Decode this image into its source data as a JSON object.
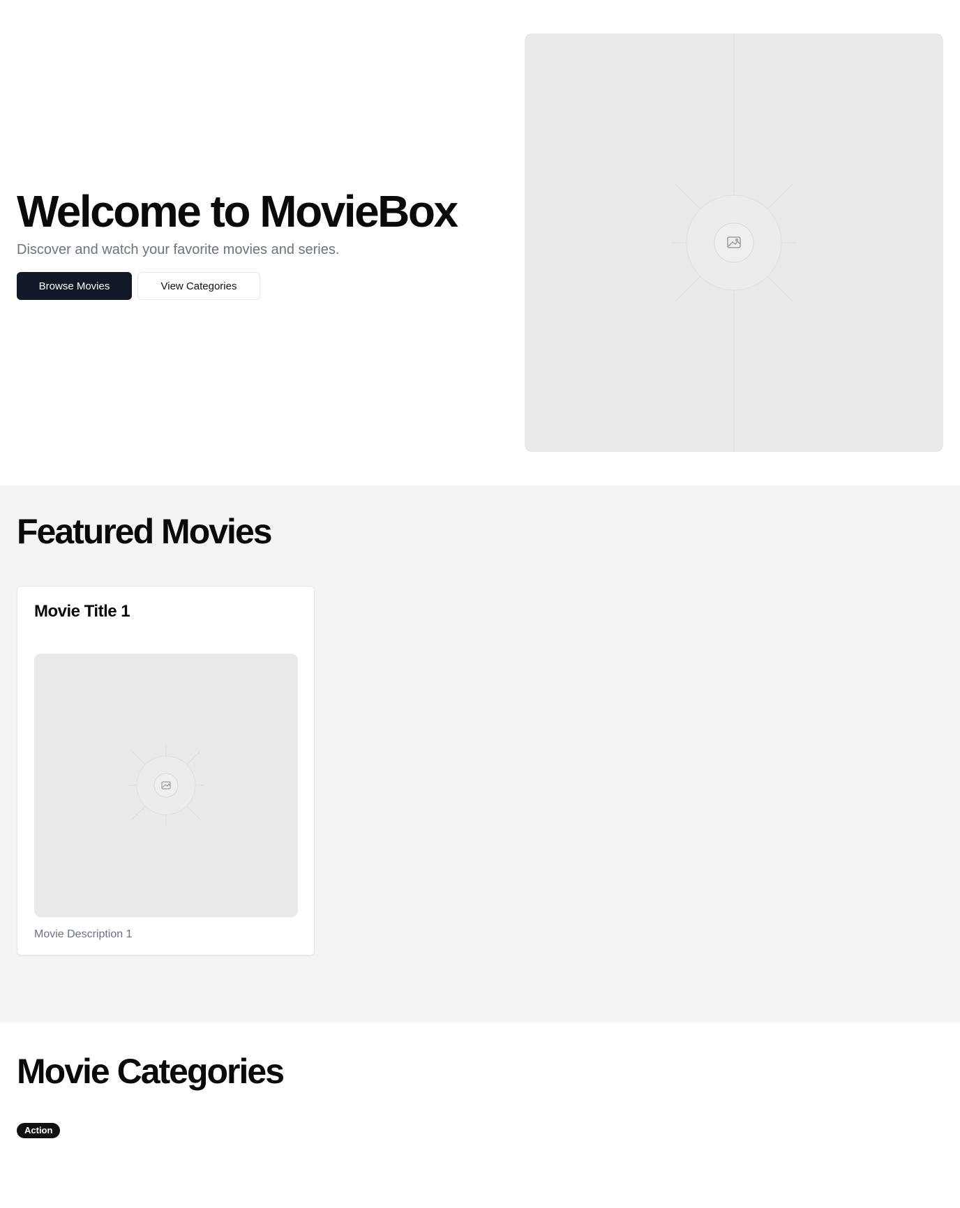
{
  "hero": {
    "title": "Welcome to MovieBox",
    "subtitle": "Discover and watch your favorite movies and series.",
    "primary_button": "Browse Movies",
    "secondary_button": "View Categories",
    "image_icon": "image-placeholder-icon"
  },
  "featured": {
    "title": "Featured Movies",
    "movies": [
      {
        "title": "Movie Title 1",
        "description": "Movie Description 1",
        "image_icon": "image-placeholder-icon"
      }
    ]
  },
  "categories": {
    "title": "Movie Categories",
    "items": [
      "Action"
    ]
  },
  "colors": {
    "primary": "#111827",
    "featured_background": "#f3f4f6",
    "muted_text": "#6b7280",
    "placeholder": "#e9e9e9",
    "badge": "#111111"
  }
}
